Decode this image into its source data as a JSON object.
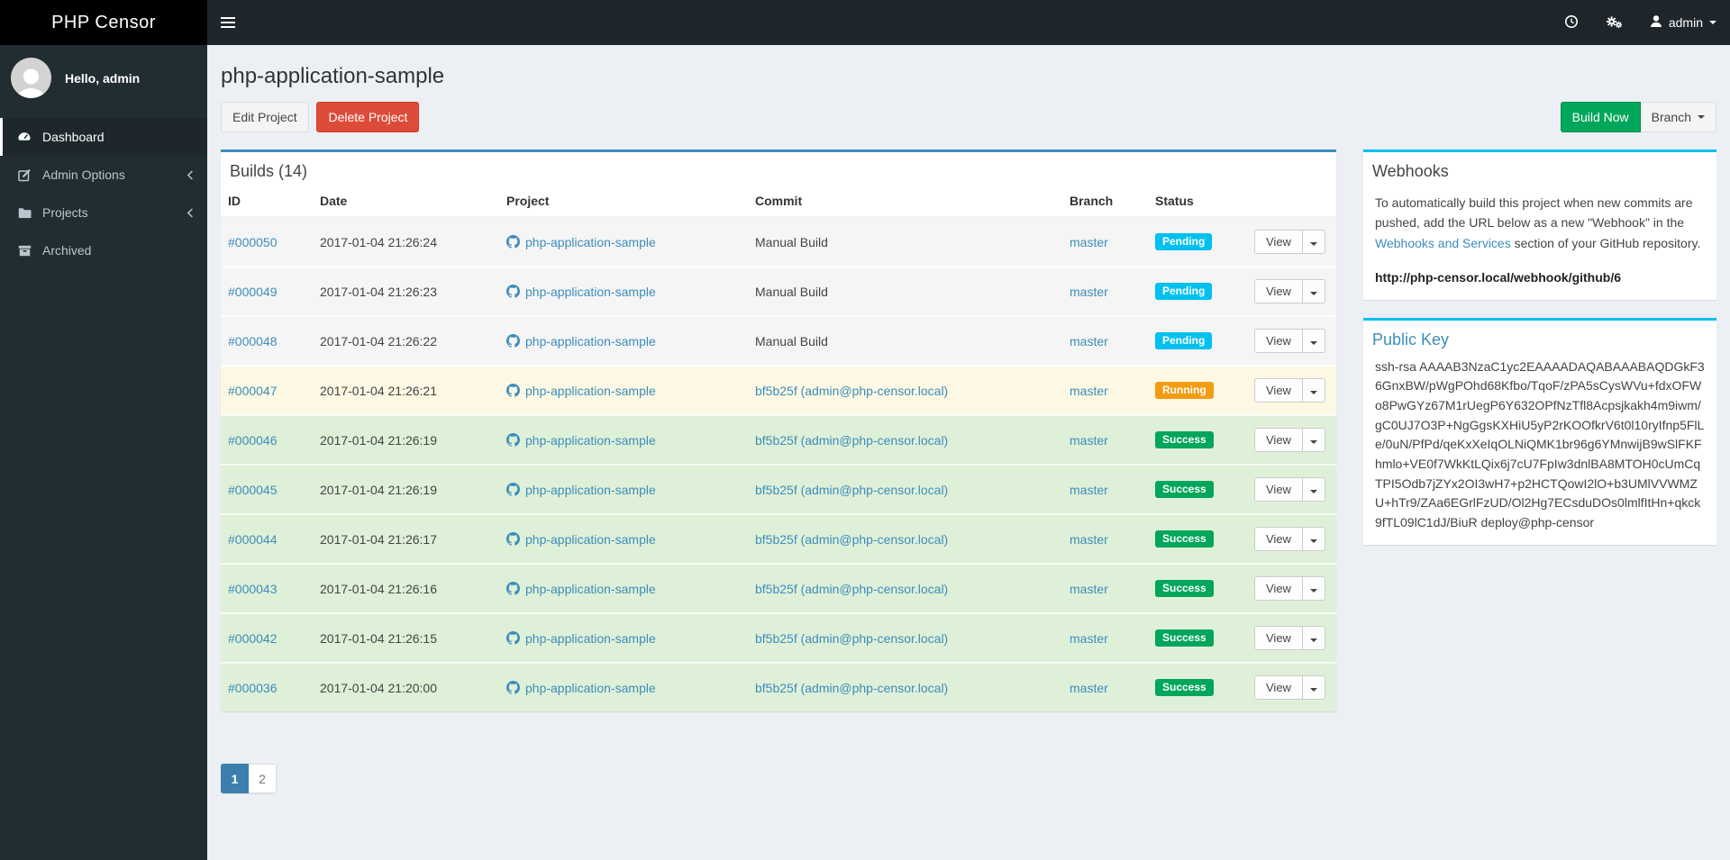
{
  "brand": {
    "title": "PHP Censor"
  },
  "navbar": {
    "user_label": "admin",
    "icons": [
      "hamburger",
      "clock",
      "cogs",
      "user",
      "caret-down"
    ]
  },
  "sidebar": {
    "greeting": "Hello, admin",
    "items": [
      {
        "label": "Dashboard",
        "icon": "dashboard-icon",
        "active": true,
        "has_children": false
      },
      {
        "label": "Admin Options",
        "icon": "edit-icon",
        "active": false,
        "has_children": true
      },
      {
        "label": "Projects",
        "icon": "folder-icon",
        "active": false,
        "has_children": true
      },
      {
        "label": "Archived",
        "icon": "archive-icon",
        "active": false,
        "has_children": false
      }
    ]
  },
  "page": {
    "title": "php-application-sample"
  },
  "toolbar": {
    "edit_label": "Edit Project",
    "delete_label": "Delete Project",
    "build_label": "Build Now",
    "branch_label": "Branch"
  },
  "builds_panel": {
    "title": "Builds (14)",
    "columns": [
      "ID",
      "Date",
      "Project",
      "Commit",
      "Branch",
      "Status"
    ],
    "view_label": "View",
    "rows": [
      {
        "id": "#000050",
        "date": "2017-01-04 21:26:24",
        "project": "php-application-sample",
        "commit": "Manual Build",
        "commit_is_link": false,
        "branch": "master",
        "status": "Pending",
        "state": "pending"
      },
      {
        "id": "#000049",
        "date": "2017-01-04 21:26:23",
        "project": "php-application-sample",
        "commit": "Manual Build",
        "commit_is_link": false,
        "branch": "master",
        "status": "Pending",
        "state": "pending"
      },
      {
        "id": "#000048",
        "date": "2017-01-04 21:26:22",
        "project": "php-application-sample",
        "commit": "Manual Build",
        "commit_is_link": false,
        "branch": "master",
        "status": "Pending",
        "state": "pending"
      },
      {
        "id": "#000047",
        "date": "2017-01-04 21:26:21",
        "project": "php-application-sample",
        "commit": "bf5b25f (admin@php-censor.local)",
        "commit_is_link": true,
        "branch": "master",
        "status": "Running",
        "state": "running"
      },
      {
        "id": "#000046",
        "date": "2017-01-04 21:26:19",
        "project": "php-application-sample",
        "commit": "bf5b25f (admin@php-censor.local)",
        "commit_is_link": true,
        "branch": "master",
        "status": "Success",
        "state": "success"
      },
      {
        "id": "#000045",
        "date": "2017-01-04 21:26:19",
        "project": "php-application-sample",
        "commit": "bf5b25f (admin@php-censor.local)",
        "commit_is_link": true,
        "branch": "master",
        "status": "Success",
        "state": "success"
      },
      {
        "id": "#000044",
        "date": "2017-01-04 21:26:17",
        "project": "php-application-sample",
        "commit": "bf5b25f (admin@php-censor.local)",
        "commit_is_link": true,
        "branch": "master",
        "status": "Success",
        "state": "success"
      },
      {
        "id": "#000043",
        "date": "2017-01-04 21:26:16",
        "project": "php-application-sample",
        "commit": "bf5b25f (admin@php-censor.local)",
        "commit_is_link": true,
        "branch": "master",
        "status": "Success",
        "state": "success"
      },
      {
        "id": "#000042",
        "date": "2017-01-04 21:26:15",
        "project": "php-application-sample",
        "commit": "bf5b25f (admin@php-censor.local)",
        "commit_is_link": true,
        "branch": "master",
        "status": "Success",
        "state": "success"
      },
      {
        "id": "#000036",
        "date": "2017-01-04 21:20:00",
        "project": "php-application-sample",
        "commit": "bf5b25f (admin@php-censor.local)",
        "commit_is_link": true,
        "branch": "master",
        "status": "Success",
        "state": "success"
      }
    ]
  },
  "pagination": {
    "pages": [
      "1",
      "2"
    ],
    "active": "1"
  },
  "webhooks_panel": {
    "title": "Webhooks",
    "body_before_link": "To automatically build this project when new commits are pushed, add the URL below as a new \"Webhook\" in the ",
    "link_text": "Webhooks and Services",
    "body_after_link": " section of your GitHub repository.",
    "webhook_url": "http://php-censor.local/webhook/github/6"
  },
  "public_key_panel": {
    "title": "Public Key",
    "key": "ssh-rsa AAAAB3NzaC1yc2EAAAADAQABAAABAQDGkF36GnxBW/pWgPOhd68Kfbo/TqoF/zPA5sCysWVu+fdxOFWo8PwGYz67M1rUegP6Y632OPfNzTfl8Acpsjkakh4m9iwm/gC0UJ7O3P+NgGgsKXHiU5yP2rKOOfkrV6t0l10ryIfnp5FlLe/0uN/PfPd/qeKxXeIqOLNiQMK1br96g6YMnwijB9wSlFKFhmlo+VE0f7WkKtLQix6j7cU7FpIw3dnlBA8MTOH0cUmCqTPI5Odb7jZYx2OI3wH7+p2HCTQowI2lO+b3UMlVVWMZU+hTr9/ZAa6EGrlFzUD/Ol2Hg7ECsduDOs0lmlfItHn+qkck9fTL09lC1dJ/BiuR deploy@php-censor"
  },
  "colors": {
    "accent_blue": "#3c8dbc",
    "info_cyan": "#00c0ef",
    "success_green": "#00a65a",
    "warning_orange": "#f39c12",
    "danger_red": "#dd4b39",
    "status": {
      "pending": "#00c0ef",
      "running": "#f39c12",
      "success": "#00a65a"
    },
    "rows": {
      "pending": "#f5f5f5",
      "running": "#fcf8e3",
      "success": "#dff0d8"
    }
  }
}
